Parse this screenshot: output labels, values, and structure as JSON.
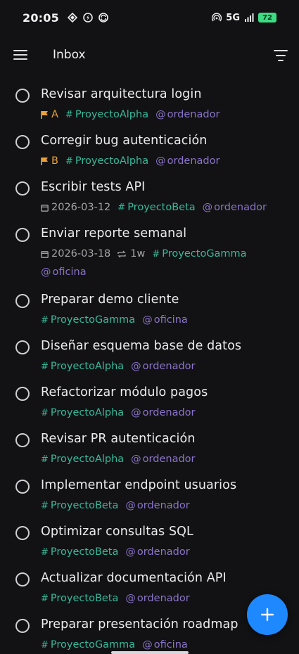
{
  "status_bar": {
    "time": "20:05",
    "network": "5G",
    "battery": "72"
  },
  "app_bar": {
    "title": "Inbox"
  },
  "tasks": [
    {
      "title": "Revisar arquitectura login",
      "priority": "A",
      "projects": [
        "ProyectoAlpha"
      ],
      "contexts": [
        "ordenador"
      ]
    },
    {
      "title": "Corregir bug autenticación",
      "priority": "B",
      "projects": [
        "ProyectoAlpha"
      ],
      "contexts": [
        "ordenador"
      ]
    },
    {
      "title": "Escribir tests API",
      "date": "2026-03-12",
      "projects": [
        "ProyectoBeta"
      ],
      "contexts": [
        "ordenador"
      ]
    },
    {
      "title": "Enviar reporte semanal",
      "date": "2026-03-18",
      "repeat": "1w",
      "projects": [
        "ProyectoGamma"
      ],
      "contexts": [
        "oficina"
      ]
    },
    {
      "title": "Preparar demo cliente",
      "projects": [
        "ProyectoGamma"
      ],
      "contexts": [
        "oficina"
      ]
    },
    {
      "title": "Diseñar esquema base de datos",
      "projects": [
        "ProyectoAlpha"
      ],
      "contexts": [
        "ordenador"
      ]
    },
    {
      "title": "Refactorizar módulo pagos",
      "projects": [
        "ProyectoAlpha"
      ],
      "contexts": [
        "ordenador"
      ]
    },
    {
      "title": "Revisar PR autenticación",
      "projects": [
        "ProyectoAlpha"
      ],
      "contexts": [
        "ordenador"
      ]
    },
    {
      "title": "Implementar endpoint usuarios",
      "projects": [
        "ProyectoBeta"
      ],
      "contexts": [
        "ordenador"
      ]
    },
    {
      "title": "Optimizar consultas SQL",
      "projects": [
        "ProyectoBeta"
      ],
      "contexts": [
        "ordenador"
      ]
    },
    {
      "title": "Actualizar documentación API",
      "projects": [
        "ProyectoBeta"
      ],
      "contexts": [
        "ordenador"
      ]
    },
    {
      "title": "Preparar presentación roadmap",
      "projects": [
        "ProyectoGamma"
      ],
      "contexts": [
        "oficina"
      ]
    }
  ],
  "colors": {
    "background": "#121214",
    "priority": "#e9a23b",
    "project": "#37b99a",
    "context": "#8a74c9",
    "date": "#a5a5aa",
    "fab": "#1e88ff"
  },
  "icons": {
    "menu": "hamburger-icon",
    "filter": "filter-icon",
    "add": "plus-icon",
    "priority": "flag-icon",
    "date": "calendar-icon",
    "repeat": "repeat-icon"
  }
}
